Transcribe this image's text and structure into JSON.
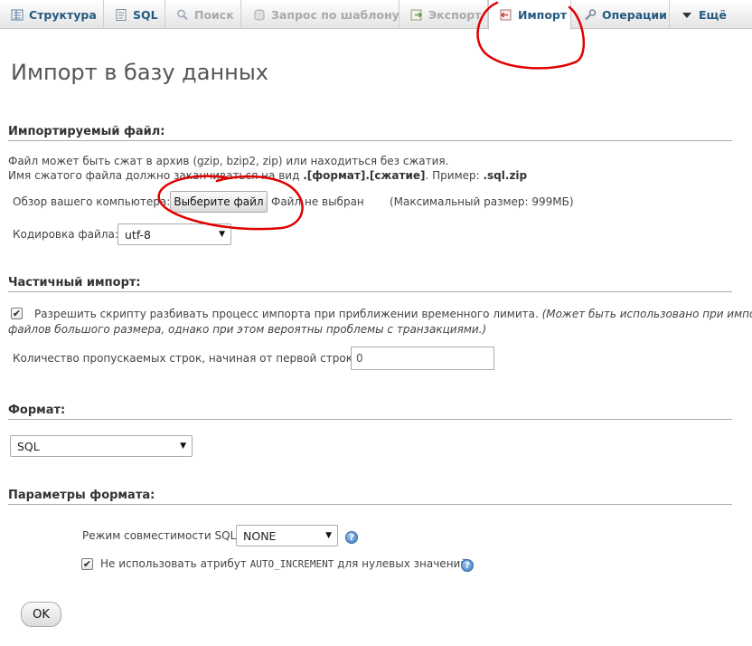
{
  "tabs": [
    {
      "label": "Структура",
      "icon": "structure-icon",
      "active": false,
      "dim": false
    },
    {
      "label": "SQL",
      "icon": "sql-icon",
      "active": false,
      "dim": false
    },
    {
      "label": "Поиск",
      "icon": "search-icon",
      "active": false,
      "dim": true
    },
    {
      "label": "Запрос по шаблону",
      "icon": "query-icon",
      "active": false,
      "dim": true
    },
    {
      "label": "Экспорт",
      "icon": "export-icon",
      "active": false,
      "dim": true
    },
    {
      "label": "Импорт",
      "icon": "import-icon",
      "active": true,
      "dim": false
    },
    {
      "label": "Операции",
      "icon": "wrench-icon",
      "active": false,
      "dim": false
    },
    {
      "label": "Ещё",
      "icon": "chevron-down-icon",
      "active": false,
      "dim": false
    }
  ],
  "page_title": "Импорт в базу данных",
  "file_section": {
    "title": "Импортируемый файл:",
    "info_line1": "Файл может быть сжат в архив (gzip, bzip2, zip) или находиться без сжатия.",
    "info_line2_prefix": "Имя сжатого файла должно заканчиваться на вид ",
    "info_line2_bold": ".[формат].[сжатие]",
    "info_line2_mid": ". Пример: ",
    "info_line2_example": ".sql.zip",
    "browse_label": "Обзор вашего компьютера:",
    "choose_button": "Выберите файл",
    "no_file": "Файл не выбран",
    "max_size": "(Максимальный размер: 999МБ)",
    "charset_label": "Кодировка файла:",
    "charset_value": "utf-8"
  },
  "partial_section": {
    "title": "Частичный импорт:",
    "allow_interrupt_label": "Разрешить скрипту разбивать процесс импорта при приближении временного лимита.",
    "allow_interrupt_note_1": " (Может быть использовано при импорте",
    "allow_interrupt_note_2": "файлов большого размера, однако при этом вероятны проблемы с транзакциями.)",
    "allow_interrupt_checked": true,
    "skip_label": "Количество пропускаемых строк, начиная от первой строки:",
    "skip_value": "0"
  },
  "format_section": {
    "title": "Формат:",
    "format_value": "SQL"
  },
  "options_section": {
    "title": "Параметры формата:",
    "compat_label": "Режим совместимости SQL:",
    "compat_value": "NONE",
    "no_auto_prefix": "Не использовать атрибут ",
    "no_auto_code": "AUTO_INCREMENT",
    "no_auto_suffix": " для нулевых значений",
    "no_auto_checked": true
  },
  "ok_button": "OK",
  "colors": {
    "link": "#235a81",
    "dim": "#aaaaaa",
    "annotation": "#e00000",
    "help": "#3a7cc0"
  }
}
